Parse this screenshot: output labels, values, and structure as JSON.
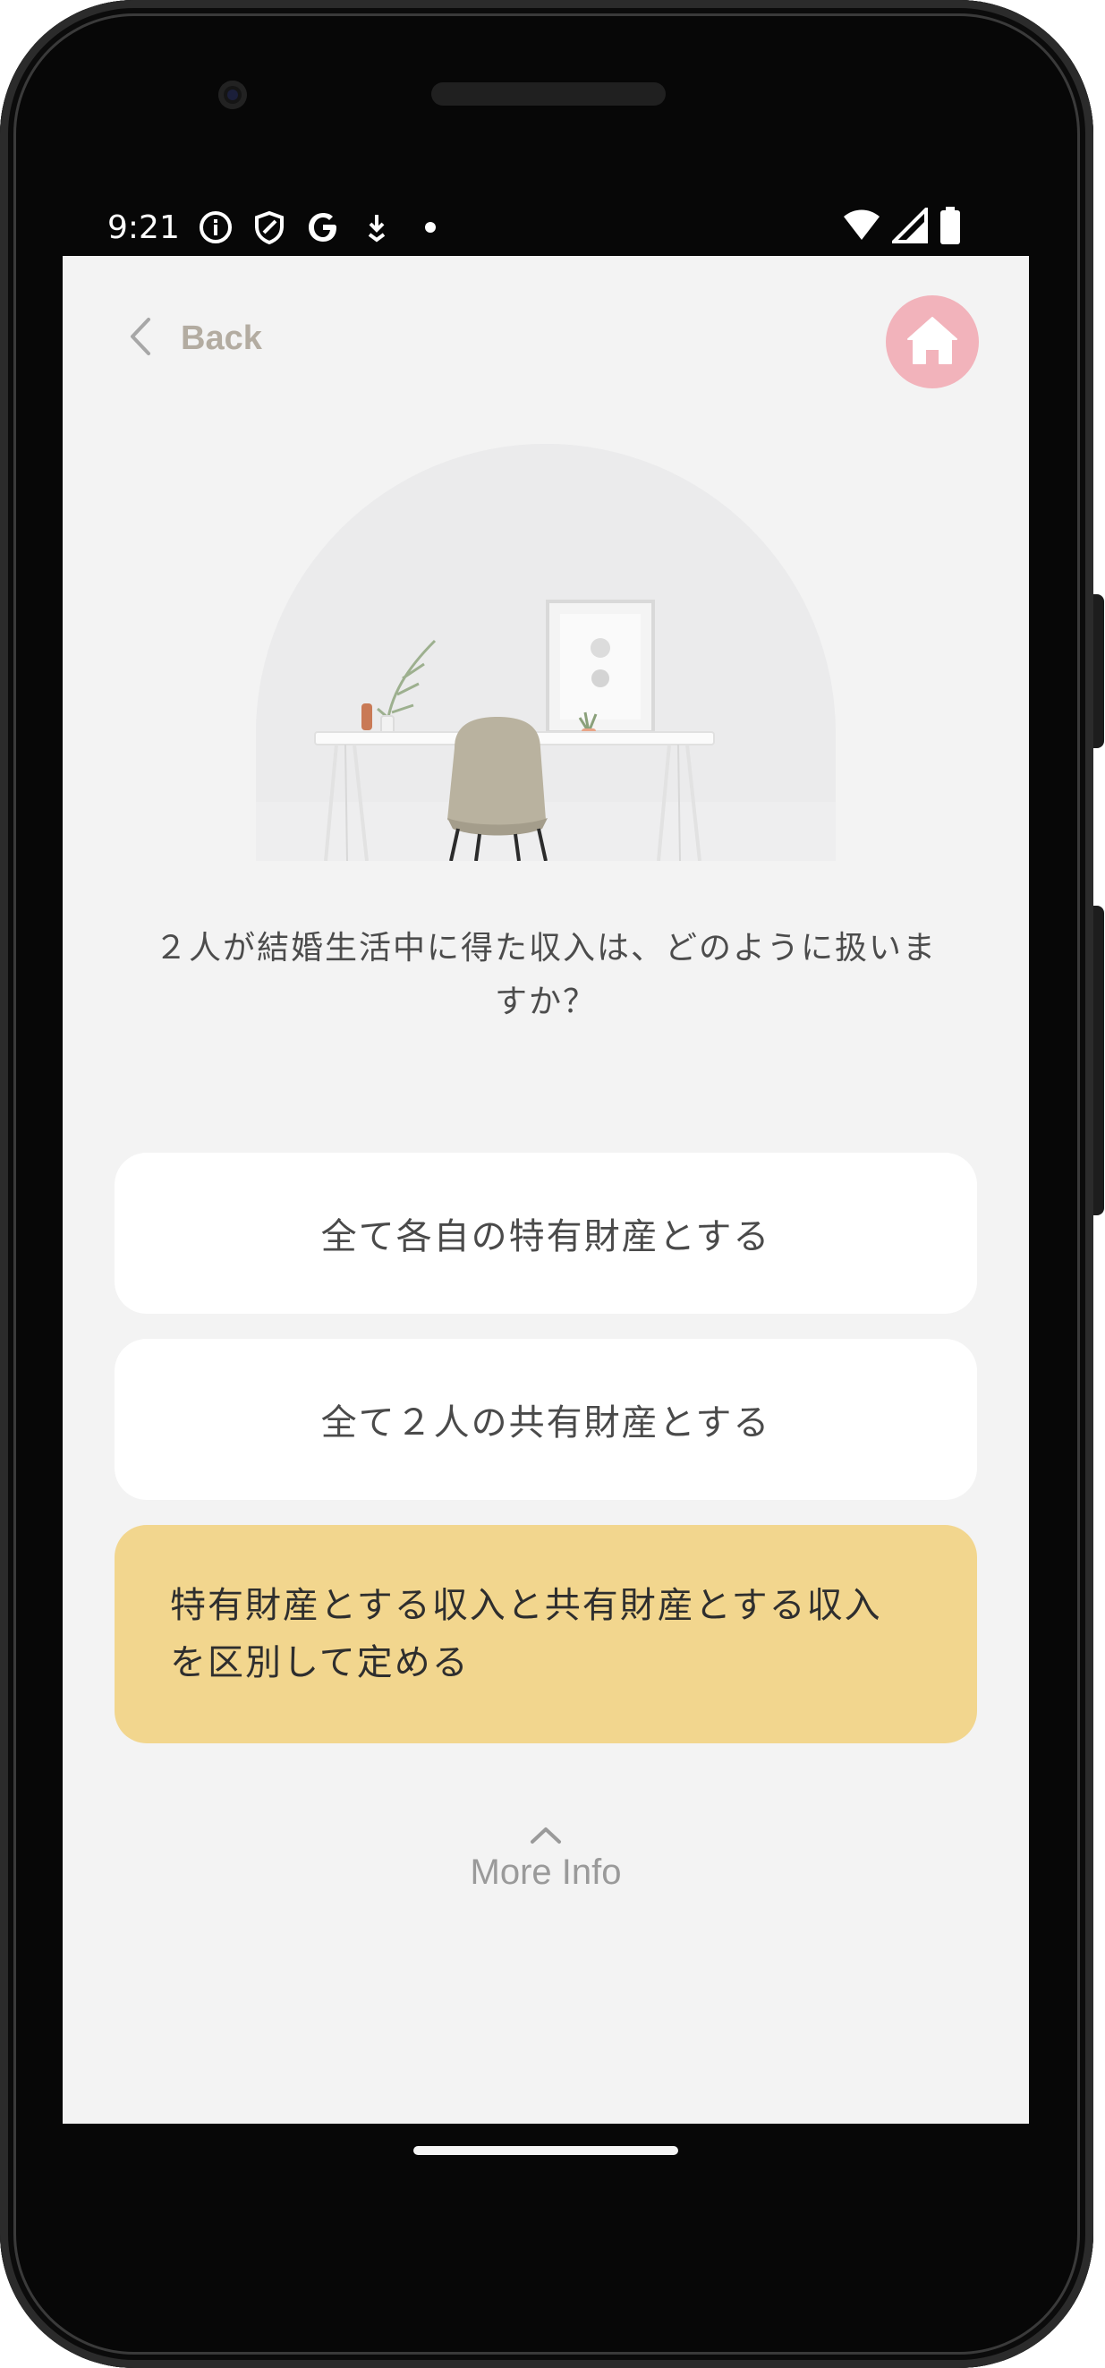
{
  "status_bar": {
    "time": "9:21",
    "left_icons": [
      "info-icon",
      "shield-icon",
      "google-icon",
      "download-icon",
      "dot-icon"
    ],
    "right_icons": [
      "wifi-icon",
      "signal-icon",
      "battery-icon"
    ]
  },
  "header": {
    "back_label": "Back",
    "home_button_color": "#f2b3bb"
  },
  "question": {
    "text": "２人が結婚生活中に得た収入は、どのように扱いますか？"
  },
  "options": [
    {
      "label": "全て各自の特有財産とする",
      "selected": false
    },
    {
      "label": "全て２人の共有財産とする",
      "selected": false
    },
    {
      "label": "特有財産とする収入と共有財産とする収入を区別して定める",
      "selected": true
    }
  ],
  "more_info": {
    "label": "More Info",
    "icon": "chevron-up-icon"
  },
  "colors": {
    "screen_bg": "#f3f3f3",
    "selected_option_bg": "#f2d68e",
    "option_bg": "#ffffff",
    "back_label": "#b3aca1"
  }
}
